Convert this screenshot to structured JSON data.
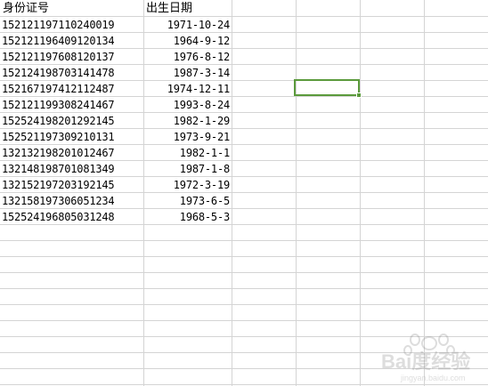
{
  "sheet": {
    "headers": [
      "身份证号",
      "出生日期"
    ],
    "rows": [
      {
        "id": "152121197110240019",
        "birth": "1971-10-24"
      },
      {
        "id": "152121196409120134",
        "birth": "1964-9-12"
      },
      {
        "id": "152121197608120137",
        "birth": "1976-8-12"
      },
      {
        "id": "152124198703141478",
        "birth": "1987-3-14"
      },
      {
        "id": "152167197412112487",
        "birth": "1974-12-11"
      },
      {
        "id": "152121199308241467",
        "birth": "1993-8-24"
      },
      {
        "id": "152524198201292145",
        "birth": "1982-1-29"
      },
      {
        "id": "152521197309210131",
        "birth": "1973-9-21"
      },
      {
        "id": "132132198201012467",
        "birth": "1982-1-1"
      },
      {
        "id": "132148198701081349",
        "birth": "1987-1-8"
      },
      {
        "id": "132152197203192145",
        "birth": "1972-3-19"
      },
      {
        "id": "132158197306051234",
        "birth": "1973-6-5"
      },
      {
        "id": "152524196805031248",
        "birth": "1968-5-3"
      }
    ]
  },
  "colors": {
    "gridline": "#d4d4d4",
    "selection": "#5b9a3c"
  },
  "watermark": {
    "text": "Bai度经验",
    "sub": "jingyan.baidu.com"
  }
}
